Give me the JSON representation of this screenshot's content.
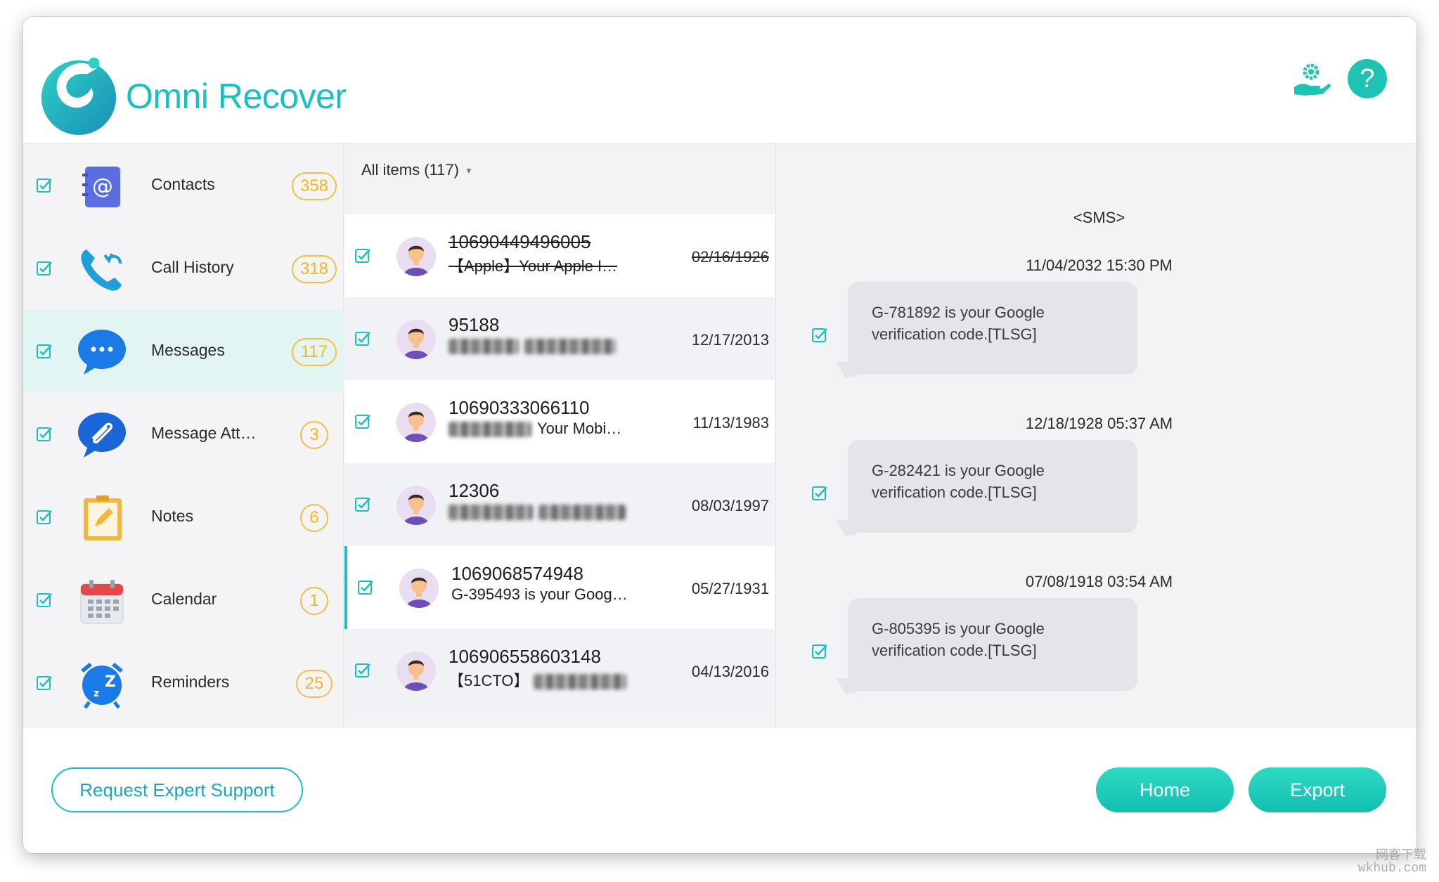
{
  "app": {
    "name": "Omni Recover"
  },
  "sidebar": {
    "items": [
      {
        "label": "Contacts",
        "count": "358",
        "icon": "contacts-book-icon"
      },
      {
        "label": "Call History",
        "count": "318",
        "icon": "phone-icon"
      },
      {
        "label": "Messages",
        "count": "117",
        "icon": "chat-bubble-icon",
        "active": true
      },
      {
        "label": "Message Att…",
        "count": "3",
        "icon": "paperclip-icon"
      },
      {
        "label": "Notes",
        "count": "6",
        "icon": "notepad-icon"
      },
      {
        "label": "Calendar",
        "count": "1",
        "icon": "calendar-icon"
      },
      {
        "label": "Reminders",
        "count": "25",
        "icon": "alarm-clock-icon"
      }
    ]
  },
  "list": {
    "filter_label": "All items (117)",
    "rows": [
      {
        "title": "10690449496005",
        "preview": "【Apple】Your Apple I…",
        "date": "02/16/1926",
        "deleted": true
      },
      {
        "title": "95188",
        "preview": "",
        "date": "12/17/2013"
      },
      {
        "title": "10690333066110",
        "preview": "Your Mobi…",
        "date": "11/13/1983"
      },
      {
        "title": "12306",
        "preview": "",
        "date": "08/03/1997"
      },
      {
        "title": "1069068574948",
        "preview": "G-395493 is your Goog…",
        "date": "05/27/1931",
        "selected": true
      },
      {
        "title": "106906558603148",
        "preview": "【51CTO】",
        "date": "04/13/2016"
      }
    ]
  },
  "detail": {
    "header": "<SMS>",
    "conversation": [
      {
        "timestamp": "11/04/2032 15:30 PM",
        "text": "G-781892 is your Google verification code.[TLSG]"
      },
      {
        "timestamp": "12/18/1928 05:37 AM",
        "text": "G-282421 is your Google verification code.[TLSG]"
      },
      {
        "timestamp": "07/08/1918 03:54 AM",
        "text": "G-805395 is your Google verification code.[TLSG]"
      }
    ]
  },
  "footer": {
    "support_label": "Request Expert Support",
    "home_label": "Home",
    "export_label": "Export"
  },
  "header_icons": {
    "help_glyph": "?"
  },
  "watermark": {
    "line1": "网客下载",
    "line2": "wkhub.com"
  },
  "colors": {
    "accent": "#1bbfc1",
    "badge": "#f2b52c",
    "button": "#14bfb2"
  }
}
